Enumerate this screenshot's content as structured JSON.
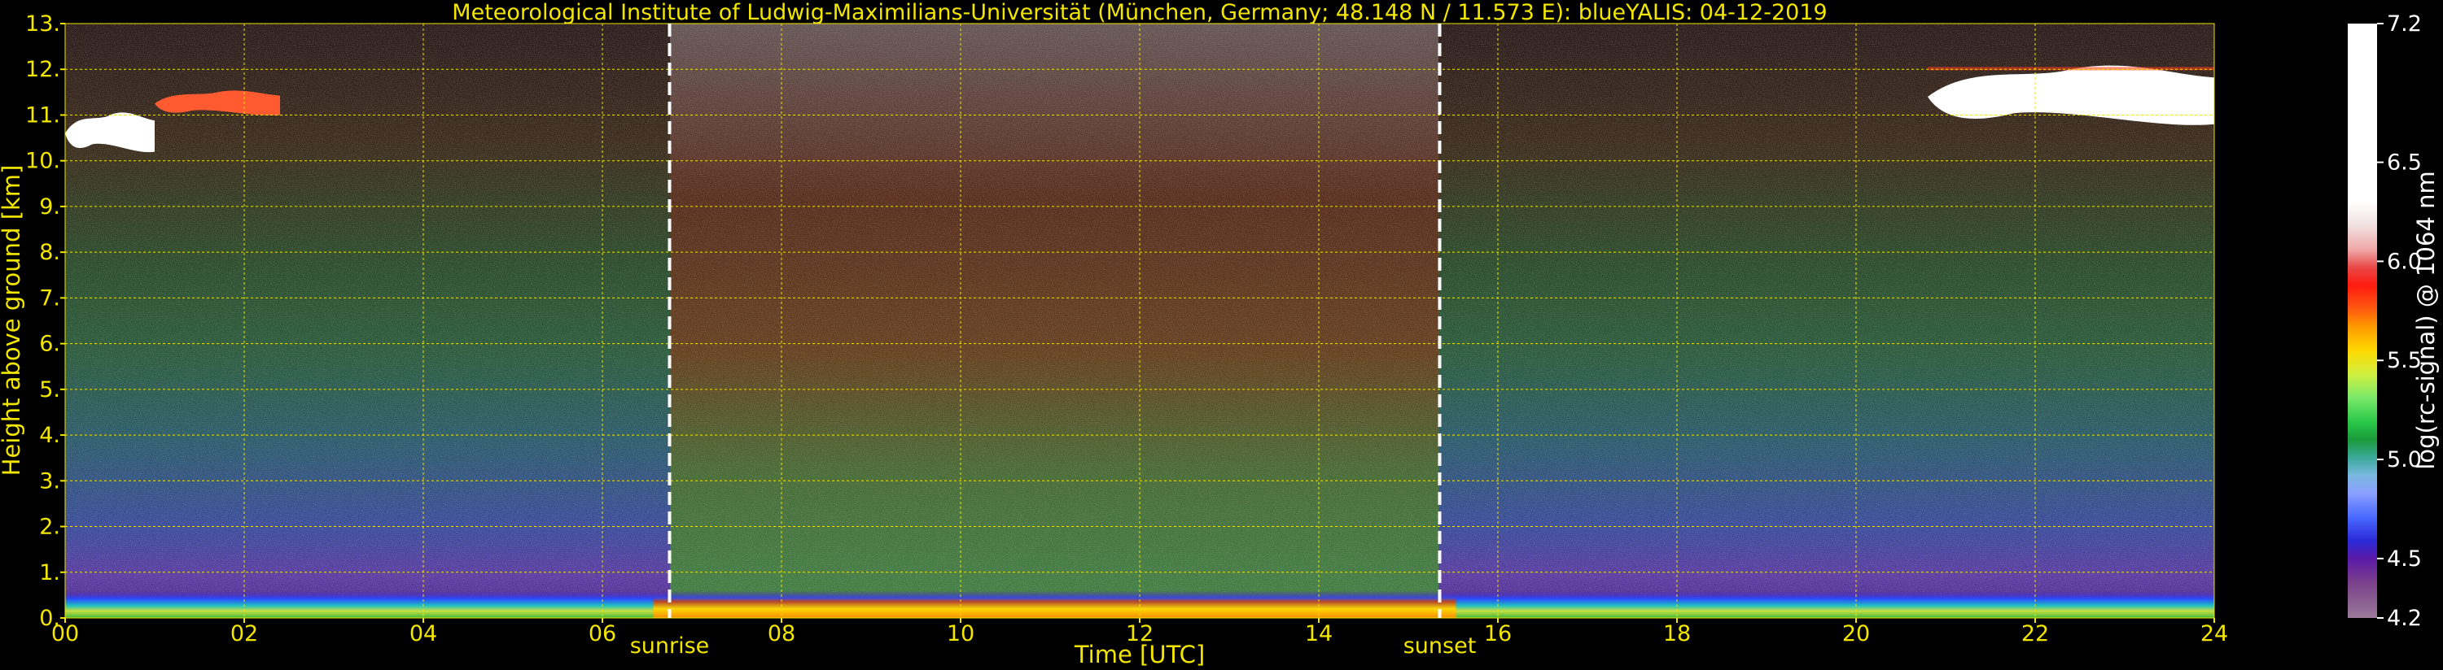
{
  "chart_data": {
    "type": "heatmap",
    "title": "Meteorological Institute of Ludwig-Maximilians-Universität (München, Germany; 48.148 N / 11.573 E):     blueYALIS: 04-12-2019",
    "xlabel": "Time [UTC]",
    "ylabel": "Height above ground [km]",
    "xlim": [
      0,
      24
    ],
    "ylim": [
      0,
      13
    ],
    "x_ticks": [
      "00",
      "02",
      "04",
      "06",
      "08",
      "10",
      "12",
      "14",
      "16",
      "18",
      "20",
      "22",
      "24"
    ],
    "x_tick_values": [
      0,
      2,
      4,
      6,
      8,
      10,
      12,
      14,
      16,
      18,
      20,
      22,
      24
    ],
    "y_ticks": [
      "0.",
      "1.",
      "2.",
      "3.",
      "4.",
      "5.",
      "6.",
      "7.",
      "8.",
      "9.",
      "10.",
      "11.",
      "12.",
      "13."
    ],
    "y_tick_values": [
      0,
      1,
      2,
      3,
      4,
      5,
      6,
      7,
      8,
      9,
      10,
      11,
      12,
      13
    ],
    "grid": true,
    "annotations": [
      {
        "label": "sunrise",
        "x": 6.75
      },
      {
        "label": "sunset",
        "x": 15.35
      }
    ],
    "colorbar": {
      "label": "log(rc-signal) @ 1064 nm",
      "range": [
        4.2,
        7.2
      ],
      "ticks": [
        "4.2",
        "4.5",
        "5.0",
        "5.5",
        "6.0",
        "6.5",
        "7.2"
      ],
      "tick_values": [
        4.2,
        4.5,
        5.0,
        5.5,
        6.0,
        6.5,
        7.2
      ]
    },
    "features": [
      {
        "name": "near-surface aerosol layer",
        "height_km": [
          0.0,
          0.6
        ],
        "value_range": [
          5.0,
          5.6
        ]
      },
      {
        "name": "cirrus cloud left",
        "time_utc": [
          0.0,
          1.0
        ],
        "height_km": [
          10.2,
          11.0
        ],
        "value": 7.2
      },
      {
        "name": "cirrus cloud upper left",
        "time_utc": [
          1.0,
          2.4
        ],
        "height_km": [
          11.0,
          11.5
        ],
        "value": 5.8
      },
      {
        "name": "cirrus cloud right",
        "time_utc": [
          20.8,
          24.0
        ],
        "height_km": [
          10.8,
          12.0
        ],
        "value": 7.2
      }
    ]
  },
  "colors": {
    "text": "#f2e600",
    "grid": "#f2e600",
    "background": "#000000",
    "markers": "#ffffff"
  }
}
